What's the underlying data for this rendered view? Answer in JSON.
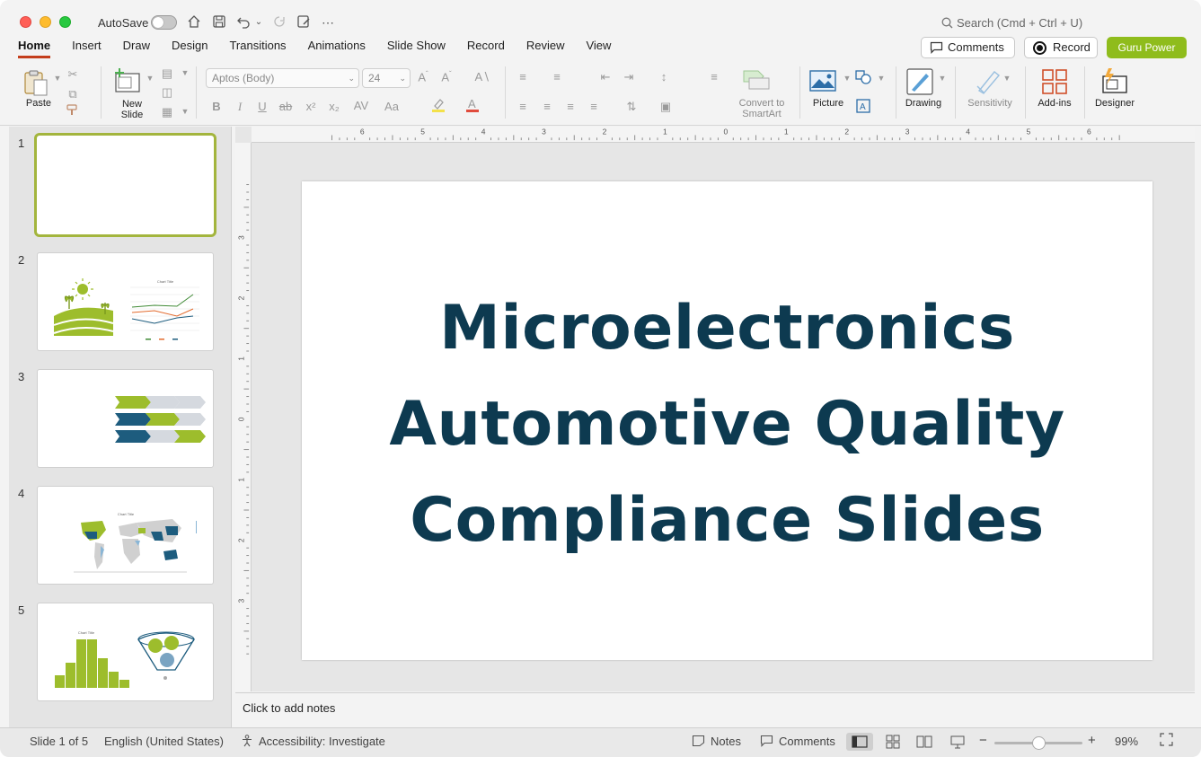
{
  "titlebar": {
    "autosave_label": "AutoSave",
    "search_placeholder": "Search (Cmd + Ctrl + U)"
  },
  "tabs": [
    {
      "label": "Home",
      "active": true
    },
    {
      "label": "Insert"
    },
    {
      "label": "Draw"
    },
    {
      "label": "Design"
    },
    {
      "label": "Transitions"
    },
    {
      "label": "Animations"
    },
    {
      "label": "Slide Show"
    },
    {
      "label": "Record"
    },
    {
      "label": "Review"
    },
    {
      "label": "View"
    }
  ],
  "header_buttons": {
    "comments": "Comments",
    "record": "Record",
    "guru": "Guru Power"
  },
  "ribbon": {
    "paste": "Paste",
    "new_slide_line1": "New",
    "new_slide_line2": "Slide",
    "font_name": "Aptos (Body)",
    "font_size": "24",
    "convert_line1": "Convert to",
    "convert_line2": "SmartArt",
    "picture": "Picture",
    "drawing": "Drawing",
    "sensitivity": "Sensitivity",
    "addins": "Add-ins",
    "designer": "Designer"
  },
  "thumbnails": [
    {
      "number": "1",
      "selected": true
    },
    {
      "number": "2"
    },
    {
      "number": "3"
    },
    {
      "number": "4"
    },
    {
      "number": "5"
    }
  ],
  "thumb_text": {
    "chart_title": "Chart Title"
  },
  "ruler": {
    "h_labels": [
      "6",
      "5",
      "4",
      "3",
      "2",
      "1",
      "0",
      "1",
      "2",
      "3",
      "4",
      "5",
      "6"
    ],
    "v_labels": [
      "3",
      "2",
      "1",
      "0",
      "1",
      "2",
      "3"
    ]
  },
  "slide": {
    "title_line1": "Microelectronics",
    "title_line2": "Automotive Quality",
    "title_line3": "Compliance Slides",
    "title_color": "#0d3a50"
  },
  "notes_placeholder": "Click to add notes",
  "status": {
    "slide_count": "Slide 1 of 5",
    "language": "English (United States)",
    "accessibility": "Accessibility: Investigate",
    "notes": "Notes",
    "comments": "Comments",
    "zoom": "99%",
    "zoom_level": 0.5
  },
  "colors": {
    "accent_green": "#8fbc1c",
    "navy": "#0d3a50",
    "teal": "#1d5c7e",
    "tab_underline": "#c43e1c"
  }
}
